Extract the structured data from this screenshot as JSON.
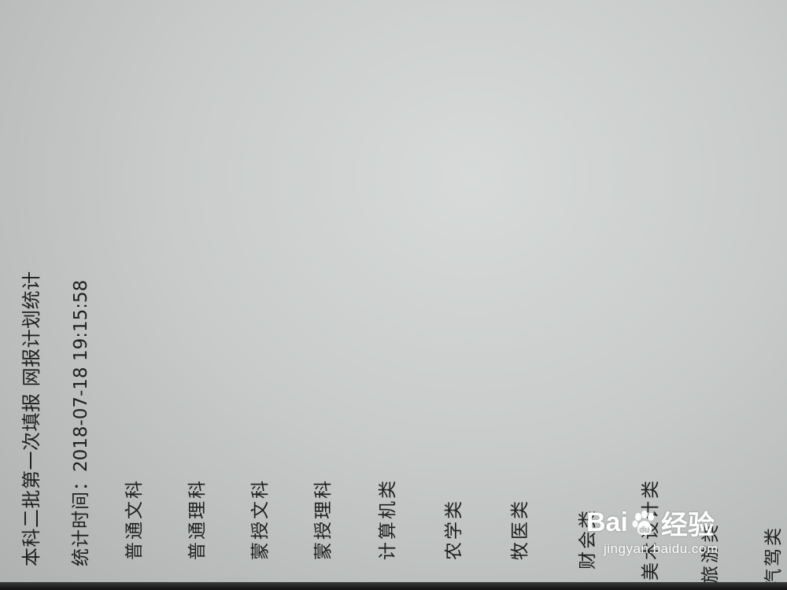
{
  "report": {
    "title": "本科二批第一次填报 网报计划统计",
    "stat_time_label": "统计时间：",
    "stat_time_value": "2018-07-18 19:15:58"
  },
  "categories": [
    "普通文科",
    "普通理科",
    "蒙授文科",
    "蒙授理科",
    "计算机类",
    "农学类",
    "牧医类",
    "财会类",
    "美术设计类",
    "旅游类",
    "汽驾类"
  ],
  "watermark": {
    "brand_left": "Bai",
    "brand_right": "经验",
    "url": "jingyan.baidu.com",
    "icon": "baidu-paw-icon"
  },
  "colors": {
    "text": "#1e1e1e",
    "screen_background": "#cfd2d1",
    "watermark": "#ffffff"
  }
}
